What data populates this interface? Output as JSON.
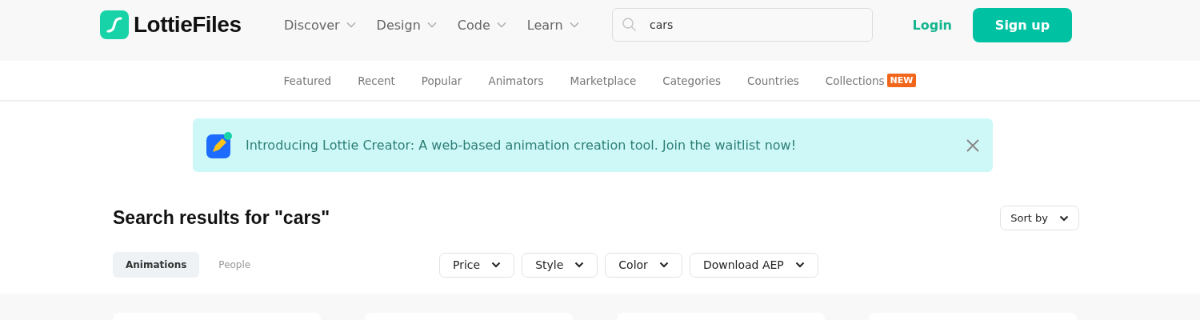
{
  "header": {
    "logo": "LottieFiles",
    "nav": [
      {
        "label": "Discover"
      },
      {
        "label": "Design"
      },
      {
        "label": "Code"
      },
      {
        "label": "Learn"
      }
    ],
    "search": {
      "value": "cars"
    },
    "login": "Login",
    "signup": "Sign up"
  },
  "subnav": [
    {
      "label": "Featured"
    },
    {
      "label": "Recent"
    },
    {
      "label": "Popular"
    },
    {
      "label": "Animators"
    },
    {
      "label": "Marketplace"
    },
    {
      "label": "Categories"
    },
    {
      "label": "Countries"
    },
    {
      "label": "Collections",
      "badge": "NEW"
    }
  ],
  "banner": {
    "text": "Introducing Lottie Creator: A web-based animation creation tool. Join the waitlist now!"
  },
  "results": {
    "title": "Search results for \"cars\"",
    "sort": "Sort by",
    "tabs": [
      {
        "label": "Animations",
        "selected": true
      },
      {
        "label": "People",
        "selected": false
      }
    ],
    "filters": [
      "Price",
      "Style",
      "Color",
      "Download AEP"
    ]
  }
}
